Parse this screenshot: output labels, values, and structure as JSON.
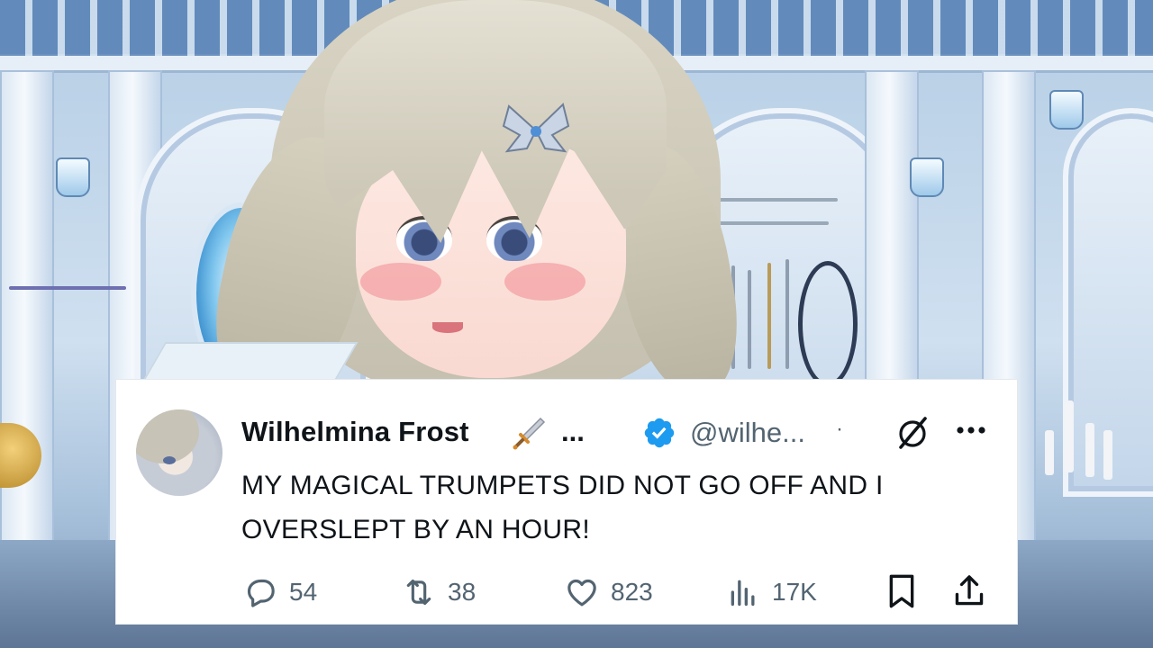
{
  "post": {
    "display_name": "Wilhelmina Frost",
    "name_emoji_icon": "dagger-icon",
    "name_truncation": "...",
    "verified_icon": "verified-badge-icon",
    "handle": "@wilhe...",
    "separator": "·",
    "text": "MY MAGICAL TRUMPETS DID NOT GO OFF AND I OVERSLEPT BY AN HOUR!",
    "actions": {
      "replies": "54",
      "reposts": "38",
      "likes": "823",
      "views": "17K"
    }
  },
  "colors": {
    "text_primary": "#0f1419",
    "text_secondary": "#536471",
    "verified_blue": "#1d9bf0"
  }
}
